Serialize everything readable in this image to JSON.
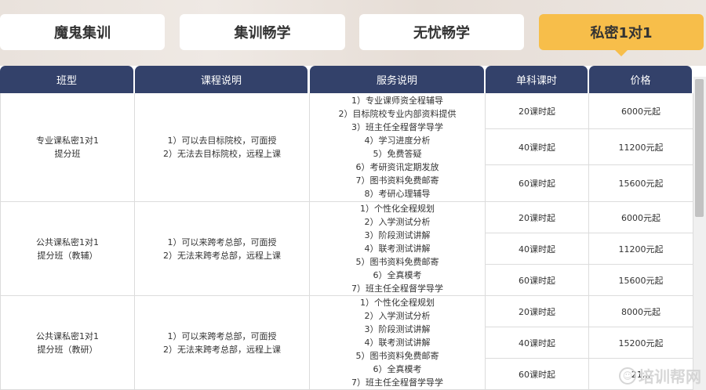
{
  "tabs": [
    {
      "label": "魔鬼集训"
    },
    {
      "label": "集训畅学"
    },
    {
      "label": "无忧畅学"
    },
    {
      "label": "私密1对1"
    }
  ],
  "headers": [
    "班型",
    "课程说明",
    "服务说明",
    "单科课时",
    "价格"
  ],
  "rows": [
    {
      "type": [
        "专业课私密1对1",
        "提分班"
      ],
      "course": [
        "1）可以去目标院校，可面授",
        "2）无法去目标院校，远程上课"
      ],
      "service": [
        "1）专业课师资全程辅导",
        "2）目标院校专业内部资料提供",
        "3）班主任全程督学导学",
        "4）学习进度分析",
        "5）免费答疑",
        "6）考研资讯定期发放",
        "7）图书资料免费邮寄",
        "8）考研心理辅导"
      ],
      "options": [
        {
          "hours": "20课时起",
          "price": "6000元起"
        },
        {
          "hours": "40课时起",
          "price": "11200元起"
        },
        {
          "hours": "60课时起",
          "price": "15600元起"
        }
      ]
    },
    {
      "type": [
        "公共课私密1对1",
        "提分班（教辅）"
      ],
      "course": [
        "1）可以来跨考总部，可面授",
        "2）无法来跨考总部，远程上课"
      ],
      "service": [
        "1）个性化全程规划",
        "2）入学测试分析",
        "3）阶段测试讲解",
        "4）联考测试讲解",
        "5）图书资料免费邮寄",
        "6）全真模考",
        "7）班主任全程督学导学"
      ],
      "options": [
        {
          "hours": "20课时起",
          "price": "6000元起"
        },
        {
          "hours": "40课时起",
          "price": "11200元起"
        },
        {
          "hours": "60课时起",
          "price": "15600元起"
        }
      ]
    },
    {
      "type": [
        "公共课私密1对1",
        "提分班（教研）"
      ],
      "course": [
        "1）可以来跨考总部，可面授",
        "2）无法来跨考总部，远程上课"
      ],
      "service": [
        "1）个性化全程规划",
        "2）入学测试分析",
        "3）阶段测试讲解",
        "4）联考测试讲解",
        "5）图书资料免费邮寄",
        "6）全真模考",
        "7）班主任全程督学导学"
      ],
      "options": [
        {
          "hours": "20课时起",
          "price": "8000元起"
        },
        {
          "hours": "40课时起",
          "price": "15200元起"
        },
        {
          "hours": "60课时起",
          "price": "21..."
        }
      ]
    }
  ],
  "watermark": {
    "text": "培训帮网",
    "icon": "smile-logo-icon"
  },
  "colors": {
    "tab_active": "#f7be4a",
    "header_bg": "#33416a",
    "border": "#dcdcdc"
  }
}
